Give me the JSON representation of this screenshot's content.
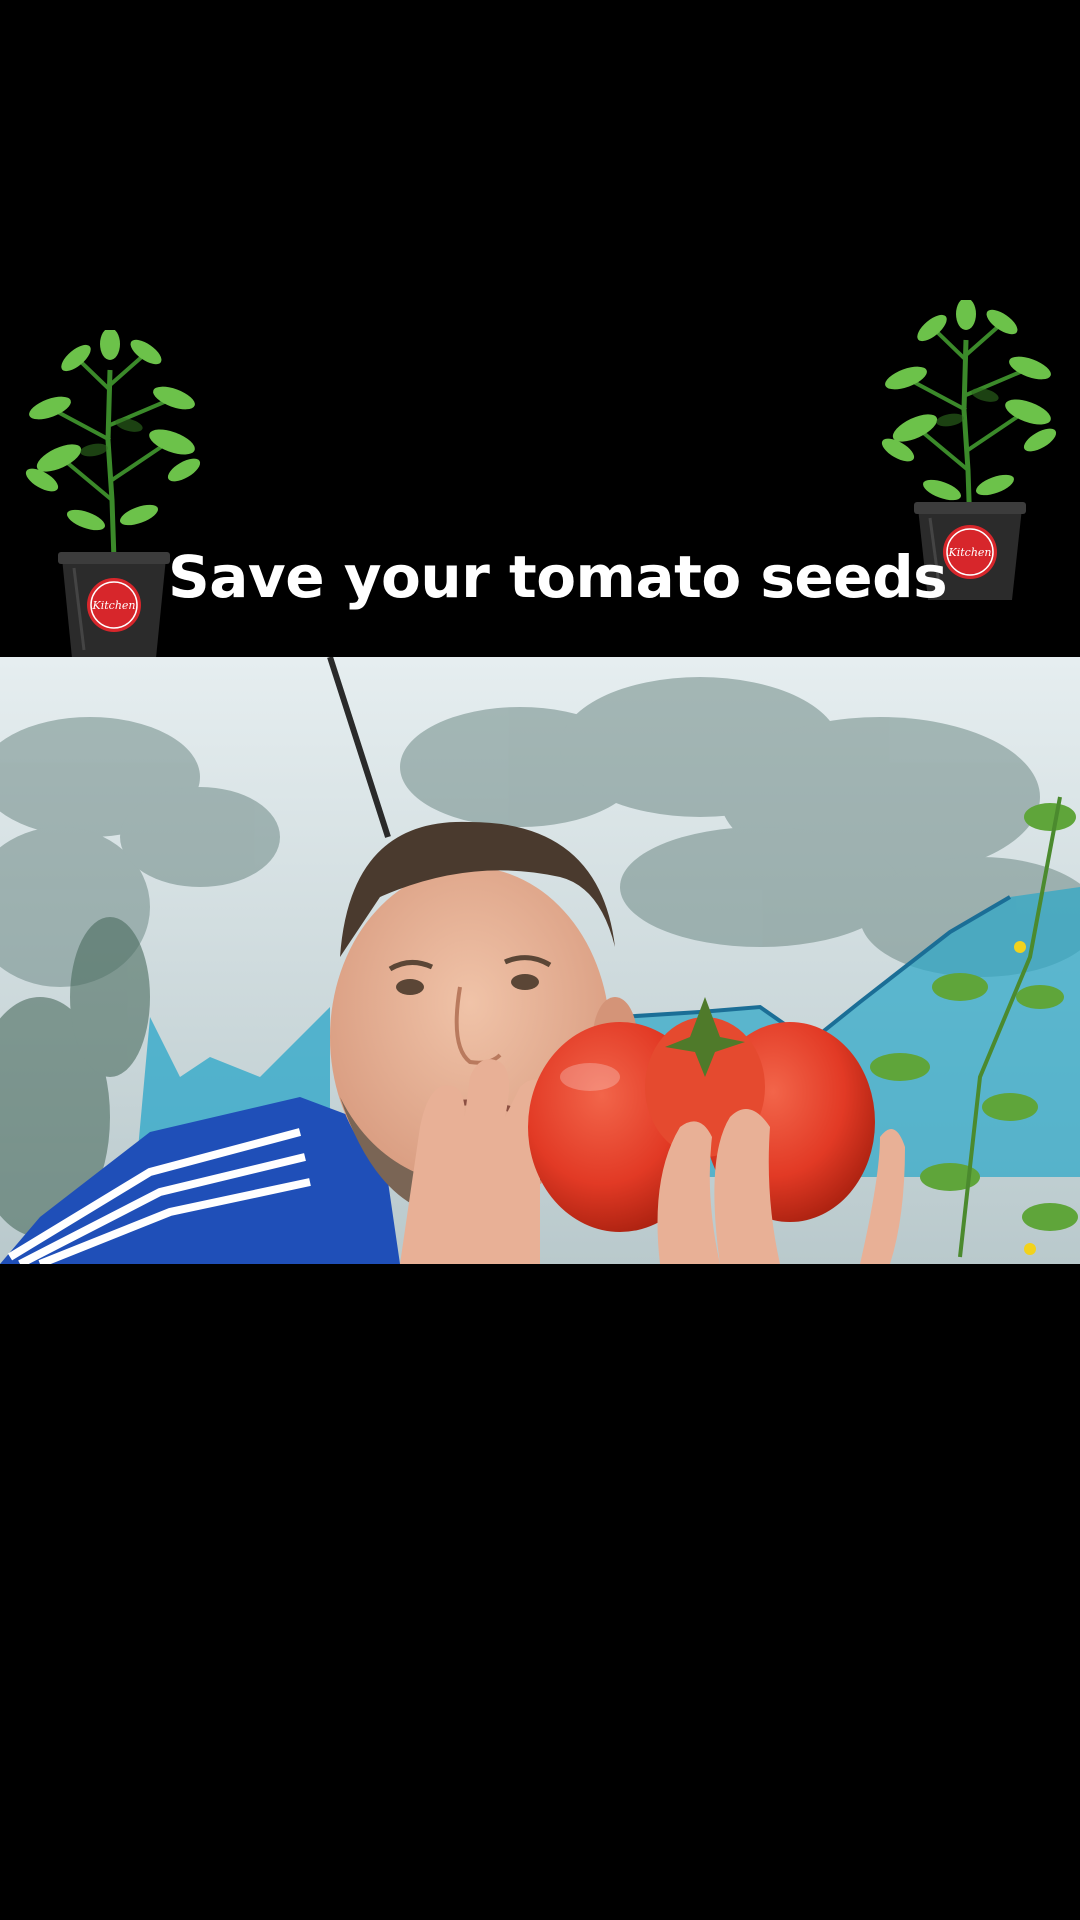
{
  "caption": {
    "text": "Save your tomato seeds"
  },
  "plant_pot": {
    "label": "Kitchen"
  },
  "colors": {
    "background": "#000000",
    "caption_text": "#ffffff",
    "pot_badge": "#d7262b",
    "tomato": "#e23a25",
    "jacket": "#1f4fb8",
    "net": "#2aa6c8"
  }
}
